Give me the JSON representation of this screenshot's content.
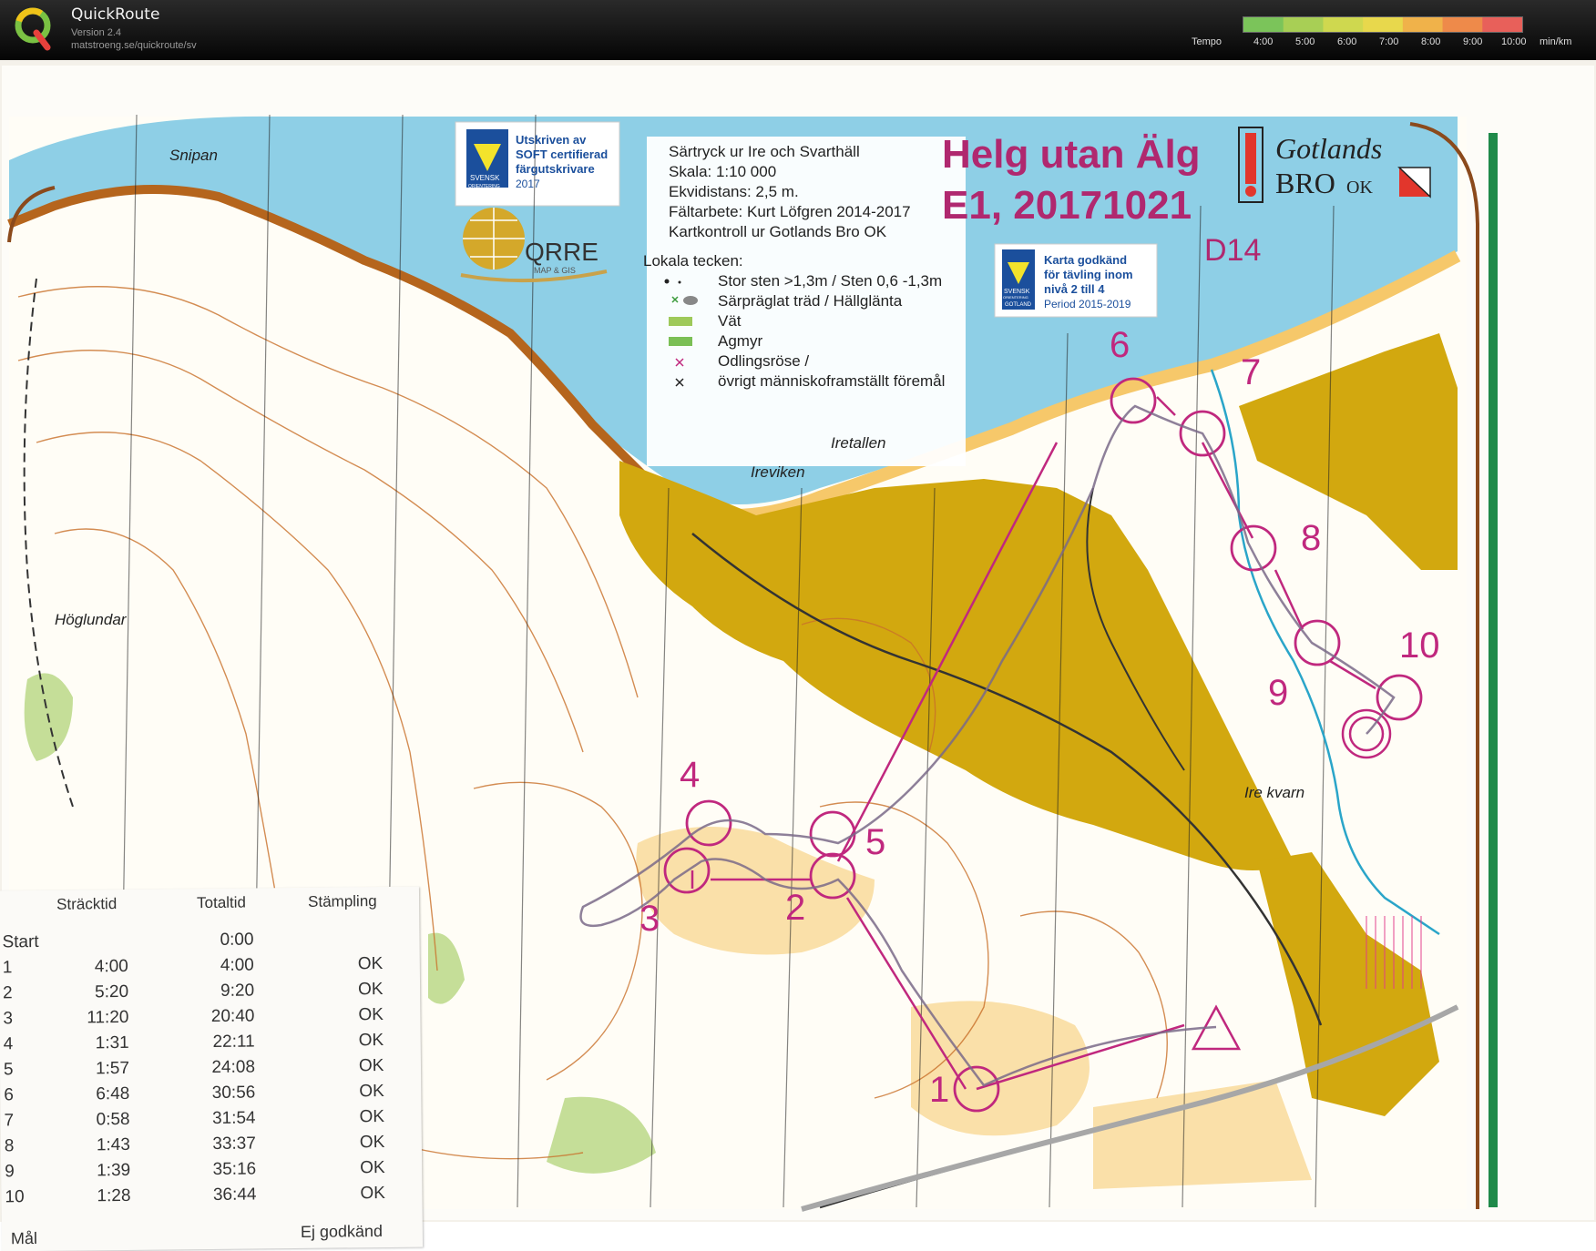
{
  "app": {
    "title": "QuickRoute",
    "version": "Version 2.4",
    "url": "matstroeng.se/quickroute/sv"
  },
  "tempo": {
    "label": "Tempo",
    "ticks": [
      "4:00",
      "5:00",
      "6:00",
      "7:00",
      "8:00",
      "9:00",
      "10:00"
    ],
    "unit": "min/km",
    "colors": [
      "#7bc45a",
      "#a8cf55",
      "#cfd84f",
      "#e8d84c",
      "#f0b24a",
      "#ee8a4a",
      "#e8605a"
    ]
  },
  "map": {
    "event_title_line1": "Helg utan Älg",
    "event_title_line2": "E1, 20171021",
    "course_class": "D14",
    "club_logo_line1": "Gotlands",
    "club_logo_line2": "BRO",
    "club_logo_line3": "OK",
    "info_lines": [
      "Särtryck ur Ire och Svarthäll",
      "Skala: 1:10 000",
      "Ekvidistans: 2,5 m.",
      "Fältarbete: Kurt Löfgren 2014-2017",
      "Kartkontroll ur Gotlands Bro OK"
    ],
    "legend_title": "Lokala tecken:",
    "legend_items": [
      "Stor sten >1,3m / Sten 0,6 -1,3m",
      "Särpräglat träd / Hällglänta",
      "Vät",
      "Agmyr",
      "Odlingsröse /",
      "övrigt människoframställt föremål"
    ],
    "soft_badge": {
      "lines": [
        "Utskriven av",
        "SOFT certifierad",
        "färgutskrivare"
      ],
      "year": "2017",
      "badge_top": "SVENSK",
      "badge_bottom": "ORIENTERING"
    },
    "qrre_logo": {
      "name": "QRRE",
      "sub": "MAP & GIS"
    },
    "approval_badge": {
      "lines": [
        "Karta godkänd",
        "för tävling inom",
        "nivå 2 till 4"
      ],
      "period": "Period 2015-2019",
      "badge_top": "SVENSK",
      "badge_mid": "ORIENTERING",
      "badge_bottom": "GOTLAND"
    },
    "place_names": [
      "Snipan",
      "Iretallen",
      "Ireviken",
      "Höglundar",
      "Ire kvarn"
    ],
    "control_numbers": [
      "1",
      "2",
      "3",
      "4",
      "5",
      "6",
      "7",
      "8",
      "9",
      "10"
    ],
    "colors": {
      "water": "#8ecfe6",
      "settlement": "#d2a80f",
      "course": "#c0287e",
      "contour": "#c9702a",
      "open_land": "#f6c86a",
      "green": "#9ec95a",
      "frame_green": "#1f8a4a"
    }
  },
  "splits": {
    "headers": [
      "Sträcktid",
      "Totaltid",
      "Stämpling"
    ],
    "rows": [
      {
        "control": "Start",
        "leg": "",
        "total": "0:00",
        "status": ""
      },
      {
        "control": "1",
        "leg": "4:00",
        "total": "4:00",
        "status": "OK"
      },
      {
        "control": "2",
        "leg": "5:20",
        "total": "9:20",
        "status": "OK"
      },
      {
        "control": "3",
        "leg": "11:20",
        "total": "20:40",
        "status": "OK"
      },
      {
        "control": "4",
        "leg": "1:31",
        "total": "22:11",
        "status": "OK"
      },
      {
        "control": "5",
        "leg": "1:57",
        "total": "24:08",
        "status": "OK"
      },
      {
        "control": "6",
        "leg": "6:48",
        "total": "30:56",
        "status": "OK"
      },
      {
        "control": "7",
        "leg": "0:58",
        "total": "31:54",
        "status": "OK"
      },
      {
        "control": "8",
        "leg": "1:43",
        "total": "33:37",
        "status": "OK"
      },
      {
        "control": "9",
        "leg": "1:39",
        "total": "35:16",
        "status": "OK"
      },
      {
        "control": "10",
        "leg": "1:28",
        "total": "36:44",
        "status": "OK"
      }
    ],
    "finish_label": "Mål",
    "final_status": "Ej godkänd"
  }
}
